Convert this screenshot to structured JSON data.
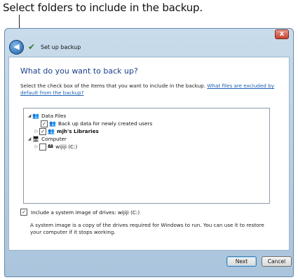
{
  "caption": "Select folders to include in the backup.",
  "window": {
    "close_label": "x",
    "title": "Set up backup",
    "heading": "What do you want to back up?",
    "description": "Select the check box of the items that you want to include in the backup.",
    "link": "What files are excluded by default from the backup?"
  },
  "tree": {
    "data_files": {
      "label": "Data Files",
      "expander": "◢"
    },
    "new_users": {
      "label": "Back up data for newly created users",
      "checked": true
    },
    "libraries": {
      "label": "mjh's Libraries",
      "expander": "▷",
      "checked": true
    },
    "computer": {
      "label": "Computer",
      "expander": "◢"
    },
    "drive": {
      "label": "wijiji (C:)",
      "expander": "▷",
      "checked": false
    }
  },
  "system_image": {
    "label": "Include a system image of drives: wijiji (C:)",
    "checked": true,
    "description": "A system image is a copy of the drives required for Windows to run. You can use it to restore your computer if it stops working."
  },
  "buttons": {
    "next": "Next",
    "cancel": "Cancel"
  },
  "icons": {
    "back": "back-arrow-icon",
    "app": "backup-icon",
    "users": "users-icon",
    "computer": "computer-icon",
    "drive": "drive-icon"
  },
  "colors": {
    "heading": "#1a3f8a",
    "link": "#1a5fb4",
    "close": "#c6402e"
  }
}
